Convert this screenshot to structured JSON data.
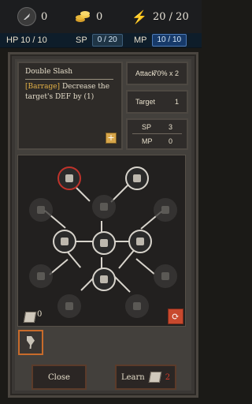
{
  "top": {
    "quills": "0",
    "coins": "0",
    "energy": "20 / 20"
  },
  "stats": {
    "hp": "HP 10 / 10",
    "sp_label": "SP",
    "sp_value": "0 / 20",
    "mp_label": "MP",
    "mp_value": "10 / 10"
  },
  "skill": {
    "name": "Double Slash",
    "tag": "[Barrage]",
    "description": "Decrease the target's DEF by (1)",
    "attack_label": "Attack",
    "attack_value": "70% x 2",
    "target_label": "Target",
    "target_value": "1",
    "sp_label": "SP",
    "sp_value": "3",
    "mp_label": "MP",
    "mp_value": "0"
  },
  "tree": {
    "book_count": "0"
  },
  "buttons": {
    "close": "Close",
    "learn": "Learn",
    "learn_cost": "2"
  },
  "colors": {
    "selected_border": "#c0332b",
    "learn_cost": "#d33c2b",
    "mp_pill": "#173a6a"
  },
  "icons": {
    "skill_points": "quill-icon",
    "gold": "coins-icon",
    "energy": "lightning-icon",
    "cycle": "refresh-icon"
  }
}
